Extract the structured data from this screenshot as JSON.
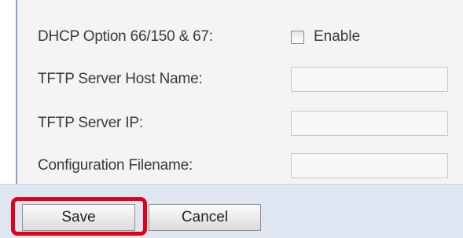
{
  "form": {
    "dhcp_option_label": "DHCP Option 66/150 & 67:",
    "enable_label": "Enable",
    "enable_checked": false,
    "tftp_host_label": "TFTP Server Host Name:",
    "tftp_host_value": "",
    "tftp_ip_label": "TFTP Server IP:",
    "tftp_ip_value": "",
    "config_filename_label": "Configuration Filename:",
    "config_filename_value": ""
  },
  "buttons": {
    "save_label": "Save",
    "cancel_label": "Cancel"
  },
  "colors": {
    "panel_background": "#f4f4f4",
    "button_bar_background": "#dfe6f2",
    "highlight": "#e2001a"
  }
}
